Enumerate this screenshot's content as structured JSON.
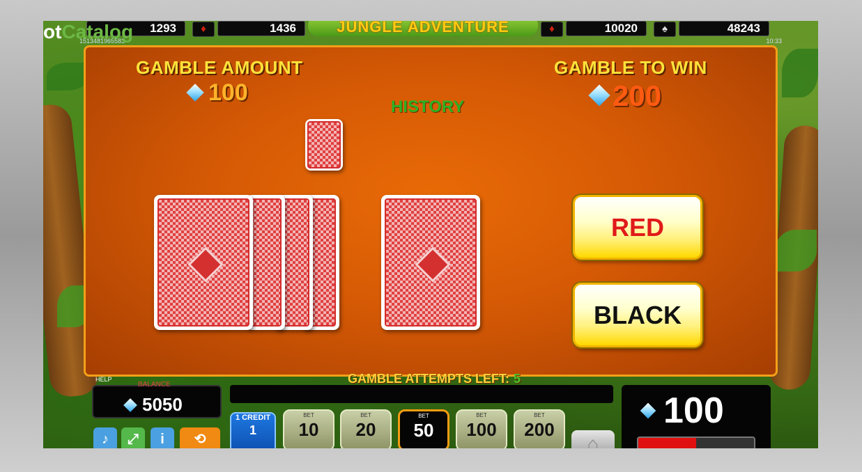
{
  "watermark": {
    "prefix": "ot",
    "main": "Catalog"
  },
  "top_bar": {
    "jackpot_values": [
      "1293",
      "1436",
      "10020",
      "48243"
    ],
    "suits": [
      "♦",
      "♦",
      "♦",
      "♠"
    ],
    "game_logo": "JUNGLE ADVENTURE",
    "session_id": "1513481965583",
    "clock": "10:33"
  },
  "gamble": {
    "amount_label": "GAMBLE AMOUNT",
    "amount_value": "100",
    "to_win_label": "GAMBLE TO WIN",
    "to_win_value": "200",
    "history_label": "HISTORY",
    "red_button": "RED",
    "black_button": "BLACK",
    "attempts_label": "GAMBLE ATTEMPTS LEFT:",
    "attempts_value": "5"
  },
  "bottom": {
    "help_label": "HELP",
    "balance_label": "BALANCE",
    "balance_value": "5050",
    "win_value": "100",
    "credit": {
      "line1": "1 CREDIT",
      "line2": "1"
    },
    "bet_label": "BET",
    "bets": [
      "10",
      "20",
      "50",
      "100",
      "200"
    ],
    "selected_bet": "50"
  },
  "icons": [
    "sound-icon",
    "fullscreen-icon",
    "info-icon",
    "autoplay-icon",
    "home-icon",
    "diamond-gem-icon"
  ],
  "colors": {
    "panel_orange": "#d65a05",
    "title_yellow": "#ffe23a",
    "amount_orange": "#ffb32a",
    "history_green": "#2fb023",
    "button_yellow": "#ffd900"
  }
}
